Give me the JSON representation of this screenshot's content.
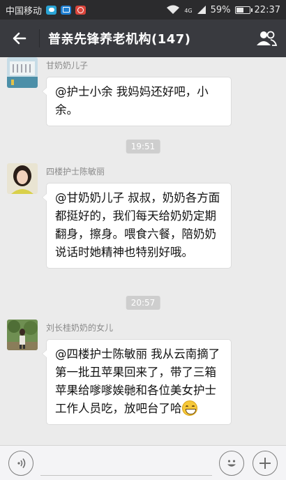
{
  "status_bar": {
    "carrier": "中国移动",
    "network": "4G",
    "battery": "59%",
    "battery_level": 0.59,
    "time": "22:37"
  },
  "header": {
    "title": "普亲先锋养老机构(147)"
  },
  "messages": [
    {
      "sender": "甘奶奶儿子",
      "text": "@护士小余 我妈妈还好吧，小余。"
    },
    {
      "timestamp": "19:51"
    },
    {
      "sender": "四楼护士陈敏丽",
      "text": "@甘奶奶儿子 叔叔，奶奶各方面都挺好的，我们每天给奶奶定期翻身，擦身。喂食六餐，陪奶奶说话时她精神也特别好哦。"
    },
    {
      "timestamp": "20:57"
    },
    {
      "sender": "刘长桂奶奶的女儿",
      "text": "@四楼护士陈敏丽 我从云南摘了第一批丑苹果回来了，带了三箱苹果给嗲嗲娭毑和各位美女护士工作人员吃，放吧台了哈",
      "emoji": "grinning-face"
    }
  ],
  "icons": {
    "back": "arrow-left-icon",
    "group": "group-members-icon",
    "voice": "voice-icon",
    "emoji": "emoji-icon",
    "more": "plus-icon"
  },
  "colors": {
    "header_bg": "#393a3f",
    "status_bg": "#2b2b2d",
    "chat_bg": "#ebebeb",
    "bubble_bg": "#ffffff"
  }
}
